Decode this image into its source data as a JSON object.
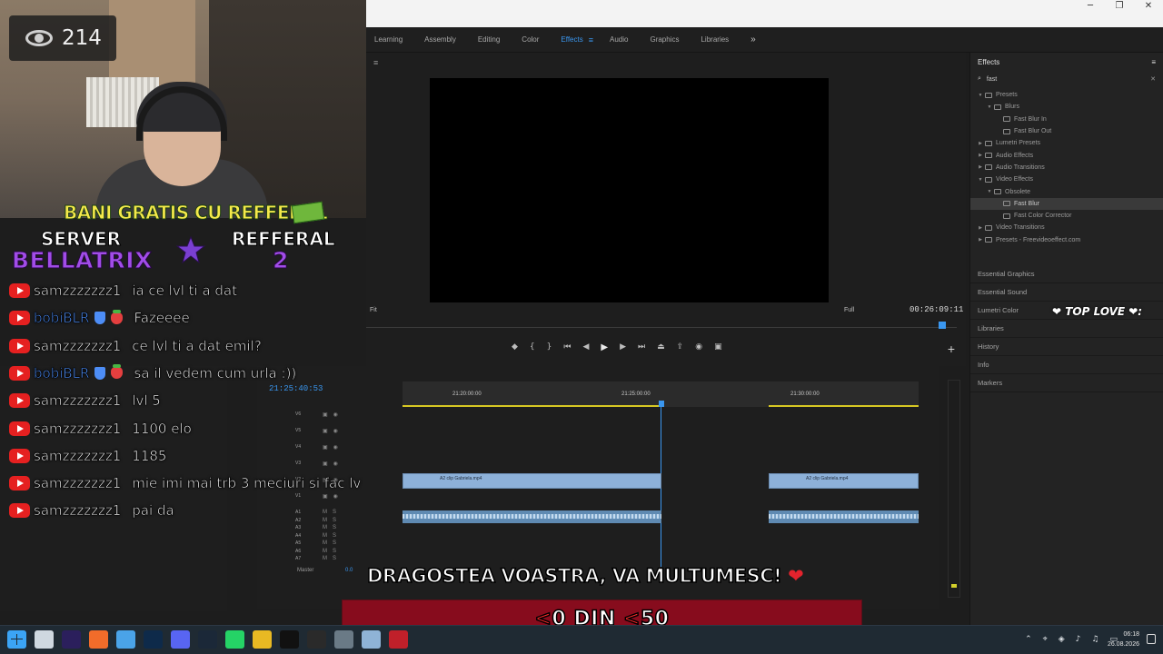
{
  "window_controls": {
    "minimize": "─",
    "maximize": "❐",
    "close": "✕"
  },
  "workspaces": [
    {
      "label": "Learning",
      "active": false
    },
    {
      "label": "Assembly",
      "active": false
    },
    {
      "label": "Editing",
      "active": false
    },
    {
      "label": "Color",
      "active": false
    },
    {
      "label": "Effects",
      "active": true
    },
    {
      "label": "Audio",
      "active": false
    },
    {
      "label": "Graphics",
      "active": false
    },
    {
      "label": "Libraries",
      "active": false
    }
  ],
  "workspace_menu_icon": "≡",
  "workspace_more_icon": "»",
  "program_monitor": {
    "timecode": "21:25:40:53",
    "fit": "Fit",
    "quality": "Full",
    "duration": "00:26:09:11",
    "add_button": "+"
  },
  "effects": {
    "title": "Effects",
    "search_value": "fast",
    "tree": [
      {
        "label": "Presets",
        "level": 0,
        "open": true,
        "selected": false
      },
      {
        "label": "Blurs",
        "level": 1,
        "open": true,
        "selected": false
      },
      {
        "label": "Fast Blur In",
        "level": 2,
        "open": false,
        "selected": false
      },
      {
        "label": "Fast Blur Out",
        "level": 2,
        "open": false,
        "selected": false
      },
      {
        "label": "Lumetri Presets",
        "level": 0,
        "open": false,
        "selected": false
      },
      {
        "label": "Audio Effects",
        "level": 0,
        "open": false,
        "selected": false
      },
      {
        "label": "Audio Transitions",
        "level": 0,
        "open": false,
        "selected": false
      },
      {
        "label": "Video Effects",
        "level": 0,
        "open": true,
        "selected": false
      },
      {
        "label": "Obsolete",
        "level": 1,
        "open": true,
        "selected": false
      },
      {
        "label": "Fast Blur",
        "level": 2,
        "open": false,
        "selected": true
      },
      {
        "label": "Fast Color Corrector",
        "level": 2,
        "open": false,
        "selected": false
      },
      {
        "label": "Video Transitions",
        "level": 0,
        "open": false,
        "selected": false
      },
      {
        "label": "Presets - Freevideoeffect.com",
        "level": 0,
        "open": false,
        "selected": false
      }
    ],
    "sections": [
      "Essential Graphics",
      "Essential Sound",
      "Lumetri Color",
      "Libraries",
      "History",
      "Info",
      "Markers"
    ]
  },
  "timeline": {
    "timecode": "21:25:40:53",
    "ruler_ticks": [
      "21:20:00:00",
      "21:25:00:00",
      "21:30:00:00"
    ],
    "tracks_video": [
      "V6",
      "V5",
      "V4",
      "V3",
      "V2",
      "V1"
    ],
    "tracks_audio": [
      "A1",
      "A2",
      "A3",
      "A4",
      "A5",
      "A6",
      "A7"
    ],
    "clips": [
      "A2 clip Gabriela.mp4",
      "A2 clip Gabriela.mp4"
    ],
    "master_label": "Master",
    "master_value": "0.0"
  },
  "stream": {
    "viewer_count": "214",
    "promo": "BANI GRATIS CU REFFERAL",
    "server_label": "SERVER",
    "server_name": "BELLATRIX",
    "referral_label": "REFFERAL",
    "referral_value": "2",
    "chat": [
      {
        "user": "samzzzzzzz1",
        "msg": "ia ce lvl ti a dat",
        "mod": false
      },
      {
        "user": "bobiBLR",
        "msg": "Fazeeee",
        "mod": true
      },
      {
        "user": "samzzzzzzz1",
        "msg": "ce lvl ti a dat emil?",
        "mod": false
      },
      {
        "user": "bobiBLR",
        "msg": "sa il vedem cum urla :))",
        "mod": true
      },
      {
        "user": "samzzzzzzz1",
        "msg": "lvl 5",
        "mod": false
      },
      {
        "user": "samzzzzzzz1",
        "msg": "1100 elo",
        "mod": false
      },
      {
        "user": "samzzzzzzz1",
        "msg": "1185",
        "mod": false
      },
      {
        "user": "samzzzzzzz1",
        "msg": "mie imi mai trb 3 meciuri si fac lv",
        "mod": false
      },
      {
        "user": "samzzzzzzz1",
        "msg": "pai da",
        "mod": false
      }
    ],
    "top_love": "TOP LOVE",
    "thanks": "DRAGOSTEA VOASTRA, VA MULTUMESC!",
    "goal_current": "0",
    "goal_text": "DIN",
    "goal_target": "50"
  },
  "taskbar": {
    "time": "06:18",
    "date": "26.08.2026",
    "apps": [
      "start-icon",
      "file-explorer-icon",
      "premiere-icon",
      "brave-icon",
      "pen-icon",
      "photoshop-icon",
      "discord-icon",
      "steam-icon",
      "whatsapp-icon",
      "folder-icon",
      "tiktok-icon",
      "obs-icon",
      "calculator-icon",
      "notepad-icon",
      "recording-icon"
    ],
    "tray": [
      "chevron-up-icon",
      "pin-icon",
      "network-icon",
      "mic-icon",
      "volume-icon",
      "display-icon"
    ]
  },
  "colors": {
    "accent": "#3a97f0",
    "premiere_bg": "#1e1e1e",
    "yt_red": "#e52020",
    "promo_yellow": "#f5e94b",
    "bella_purple": "#a14ce8",
    "goal_red": "#960a1e"
  }
}
